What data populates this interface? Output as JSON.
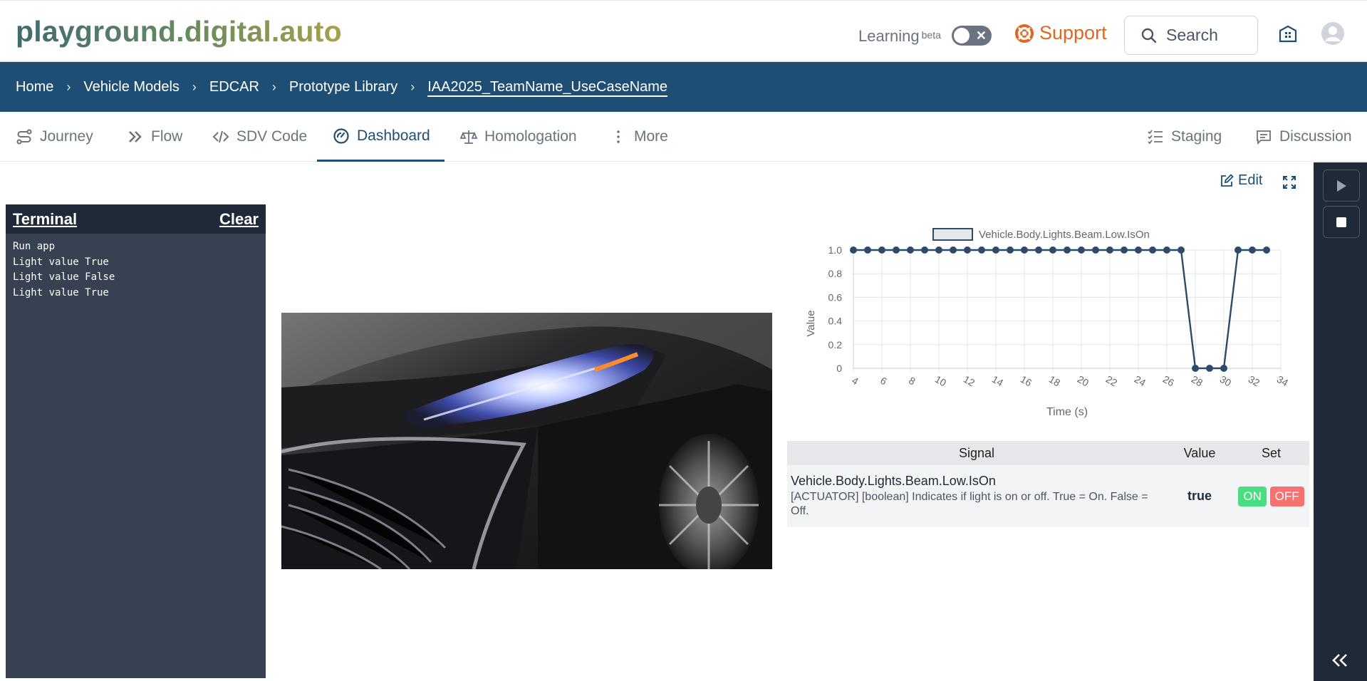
{
  "header": {
    "logo": "playground.digital.auto",
    "learning_label": "Learning",
    "learning_badge": "beta",
    "support_label": "Support",
    "search_placeholder": "Search"
  },
  "breadcrumb": [
    "Home",
    "Vehicle Models",
    "EDCAR",
    "Prototype Library",
    "IAA2025_TeamName_UseCaseName"
  ],
  "tabs": {
    "journey": "Journey",
    "flow": "Flow",
    "sdv_code": "SDV Code",
    "dashboard": "Dashboard",
    "homologation": "Homologation",
    "more": "More",
    "staging": "Staging",
    "discussion": "Discussion"
  },
  "toolbar": {
    "edit_label": "Edit"
  },
  "terminal": {
    "title": "Terminal",
    "clear_label": "Clear",
    "lines": [
      "Run app",
      "Light value True",
      "Light value False",
      "Light value True"
    ]
  },
  "signal_table": {
    "headers": [
      "Signal",
      "Value",
      "Set"
    ],
    "rows": [
      {
        "name": "Vehicle.Body.Lights.Beam.Low.IsOn",
        "description": "[ACTUATOR] [boolean]  Indicates if light is on or off. True = On. False = Off.",
        "value": "true",
        "on_label": "ON",
        "off_label": "OFF"
      }
    ]
  },
  "chart_data": {
    "type": "line",
    "legend": "Vehicle.Body.Lights.Beam.Low.IsOn",
    "xlabel": "Time (s)",
    "ylabel": "Value",
    "x": [
      4,
      5,
      6,
      7,
      8,
      9,
      10,
      11,
      12,
      13,
      14,
      15,
      16,
      17,
      18,
      19,
      20,
      21,
      22,
      23,
      24,
      25,
      26,
      27,
      28,
      29,
      30,
      31,
      32,
      33
    ],
    "series": [
      {
        "name": "Vehicle.Body.Lights.Beam.Low.IsOn",
        "values": [
          1,
          1,
          1,
          1,
          1,
          1,
          1,
          1,
          1,
          1,
          1,
          1,
          1,
          1,
          1,
          1,
          1,
          1,
          1,
          1,
          1,
          1,
          1,
          1,
          0,
          0,
          0,
          1,
          1,
          1
        ]
      }
    ],
    "xticks": [
      "4",
      "6",
      "8",
      "10",
      "12",
      "14",
      "16",
      "18",
      "20",
      "22",
      "24",
      "26",
      "28",
      "30",
      "32",
      "34"
    ],
    "yticks": [
      "0",
      "0.2",
      "0.4",
      "0.6",
      "0.8",
      "1.0"
    ],
    "xlim": [
      4,
      34
    ],
    "ylim": [
      0,
      1
    ],
    "grid": true,
    "line_color": "#2d4a6b"
  }
}
